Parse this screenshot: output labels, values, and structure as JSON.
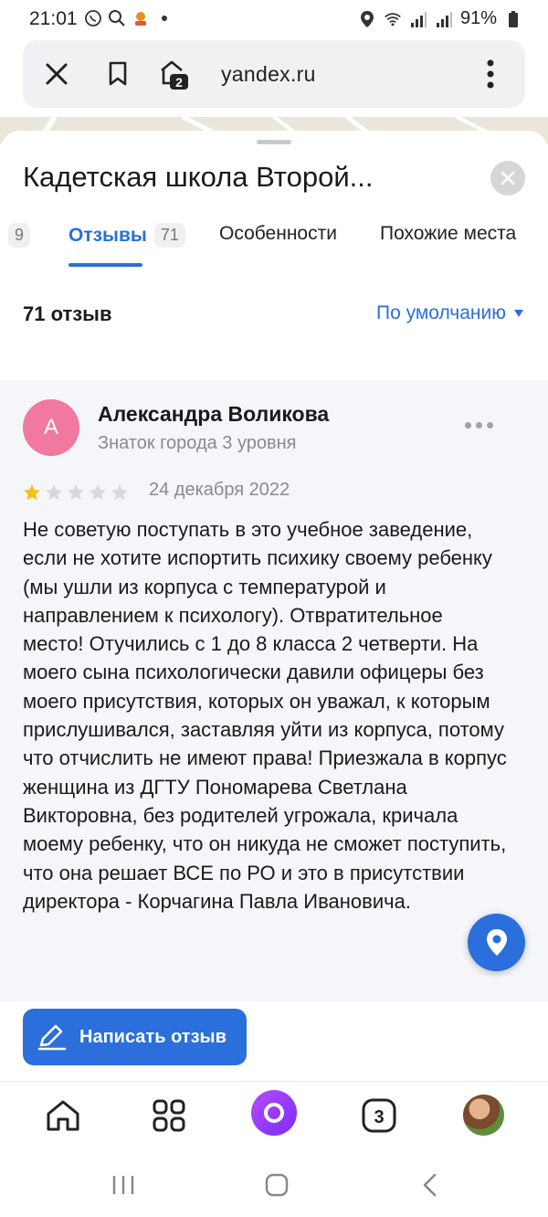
{
  "status_bar": {
    "time": "21:01",
    "battery": "91%"
  },
  "browser": {
    "url": "yandex.ru",
    "tabs_count": "2"
  },
  "place": {
    "title": "Кадетская школа Второй..."
  },
  "tabs": [
    {
      "label": "",
      "count": "9"
    },
    {
      "label": "Отзывы",
      "count": "71",
      "active": true
    },
    {
      "label": "Особенности"
    },
    {
      "label": "Похожие места"
    }
  ],
  "reviews_header": {
    "count_label": "71 отзыв",
    "sort_label": "По умолчанию"
  },
  "review": {
    "avatar_letter": "А",
    "author": "Александра Воликова",
    "level": "Знаток города 3 уровня",
    "rating": 1,
    "max_rating": 5,
    "date": "24 декабря 2022",
    "text": "Не советую поступать в это учебное заведение, если не хотите испортить психику своему ребенку (мы ушли из корпуса с температурой и направлением к психологу). Отвратительное место! Отучились с 1 до 8 класса 2 четверти. На моего сына психологически давили офицеры без моего присутствия, которых он уважал, к которым прислушивался, заставляя уйти из корпуса, потому что отчислить не имеют права! Приезжала в корпус женщина из ДГТУ Пономарева Светлана Викторовна, без родителей угрожала, кричала моему ребенку, что он никуда не сможет поступить, что она решает ВСЕ по РО и это в присутствии директора - Корчагина Павла Ивановича."
  },
  "actions": {
    "write_review": "Написать отзыв"
  },
  "bottom_nav": {
    "tabs_badge": "3"
  },
  "colors": {
    "accent": "#2a6fdb",
    "avatar": "#f1789e",
    "star_filled": "#f5c01d",
    "star_empty": "#d9d9dc"
  }
}
